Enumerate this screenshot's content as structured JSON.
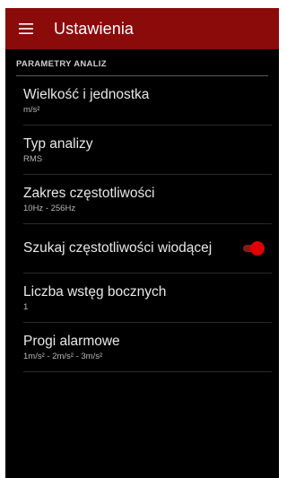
{
  "toolbar": {
    "menu_icon": "hamburger-menu-icon",
    "title": "Ustawienia",
    "color": "#8b0a0a"
  },
  "section": {
    "header": "PARAMETRY ANALIZ"
  },
  "preferences": [
    {
      "title": "Wielkość i jednostka",
      "summary": "m/s²"
    },
    {
      "title": "Typ analizy",
      "summary": "RMS"
    },
    {
      "title": "Zakres częstotliwości",
      "summary": "10Hz - 256Hz"
    },
    {
      "title": "Szukaj częstotliwości wiodącej",
      "switch_on": true,
      "switch_color": "#e00000"
    },
    {
      "title": "Liczba wstęg bocznych",
      "summary": "1"
    },
    {
      "title": "Progi alarmowe",
      "summary": "1m/s² - 2m/s² - 3m/s²"
    }
  ]
}
